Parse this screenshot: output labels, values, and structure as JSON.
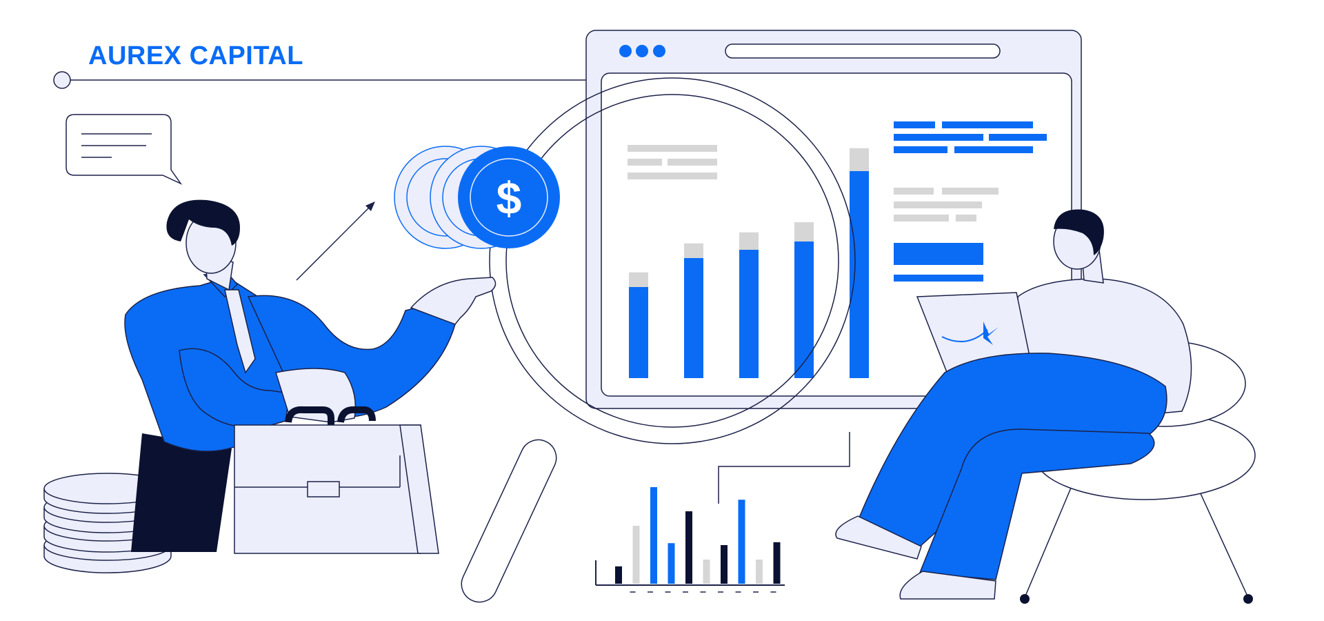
{
  "brand": {
    "name": "AUREX CAPITAL"
  },
  "coin": {
    "symbol": "$"
  },
  "colors": {
    "accent": "#0a6cf5",
    "navy": "#0b1130",
    "lavender": "#eceefb",
    "gray": "#d6d6d6",
    "outline": "#1b2148"
  },
  "dashboard_chart": {
    "bars": [
      {
        "blue": 0.44,
        "gray": 0.16
      },
      {
        "blue": 0.58,
        "gray": 0.16
      },
      {
        "blue": 0.62,
        "gray": 0.19
      },
      {
        "blue": 0.66,
        "gray": 0.21
      },
      {
        "blue": 1.0,
        "gray": 0.25
      }
    ]
  },
  "mini_chart": {
    "bars": [
      {
        "value": 0.18,
        "color": "navy"
      },
      {
        "value": 0.6,
        "color": "gray"
      },
      {
        "value": 1.0,
        "color": "blue"
      },
      {
        "value": 0.42,
        "color": "blue"
      },
      {
        "value": 0.75,
        "color": "navy"
      },
      {
        "value": 0.25,
        "color": "gray"
      },
      {
        "value": 0.4,
        "color": "navy"
      },
      {
        "value": 0.87,
        "color": "blue"
      },
      {
        "value": 0.25,
        "color": "gray"
      },
      {
        "value": 0.43,
        "color": "navy"
      }
    ]
  }
}
